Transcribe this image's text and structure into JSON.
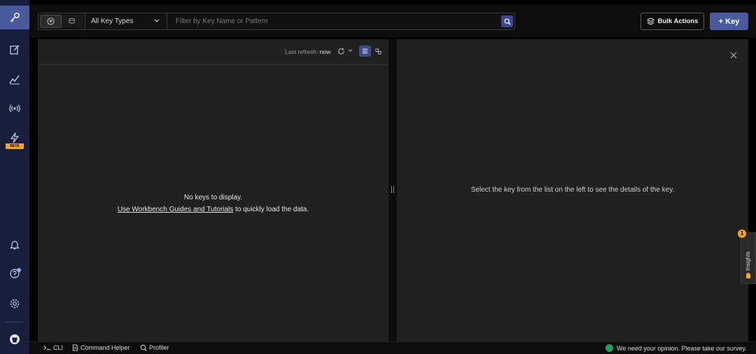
{
  "topbar": {
    "key_type_selected": "All Key Types",
    "search_placeholder": "Filter by Key Name or Pattern",
    "bulk_actions_label": "Bulk Actions",
    "add_key_label": "+ Key"
  },
  "sidebar": {
    "beta_badge": "BETA"
  },
  "key_list": {
    "last_refresh_label": "Last refresh:",
    "last_refresh_value": "now",
    "empty_title": "No keys to display.",
    "empty_link": "Use Workbench Guides and Tutorials",
    "empty_suffix": " to quickly load the data."
  },
  "details": {
    "message": "Select the key from the list on the left to see the details of the key."
  },
  "insights": {
    "label": "Insights",
    "badge_count": "1"
  },
  "bottombar": {
    "cli_label": "CLI",
    "command_helper_label": "Command Helper",
    "profiler_label": "Profiler",
    "survey_text": "We need your opinion. Please take our survey."
  },
  "colors": {
    "accent": "#4b5a9c",
    "sidebar_bg": "#181f3c",
    "panel_bg": "#212121",
    "beta": "#f0a62a",
    "survey": "#21a35b"
  }
}
